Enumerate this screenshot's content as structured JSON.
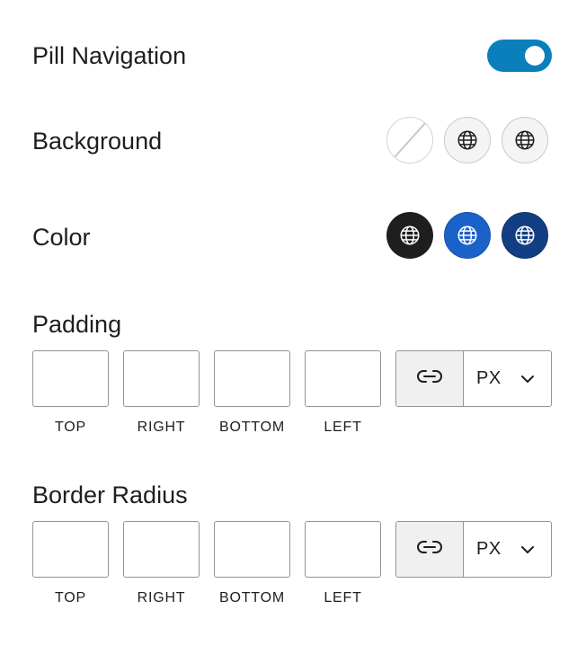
{
  "pill_navigation": {
    "label": "Pill Navigation",
    "enabled": true,
    "toggle_color": "#0a7fbc"
  },
  "background": {
    "label": "Background",
    "swatches": [
      {
        "name": "none",
        "icon": "slash-icon",
        "color": "#ffffff"
      },
      {
        "name": "light-gray",
        "icon": "globe-icon",
        "color": "#f3f4f5"
      },
      {
        "name": "light-gray-alt",
        "icon": "globe-icon",
        "color": "#f3f4f5"
      }
    ]
  },
  "color": {
    "label": "Color",
    "swatches": [
      {
        "name": "black",
        "icon": "globe-icon",
        "color": "#1e1e1e"
      },
      {
        "name": "blue",
        "icon": "globe-icon",
        "color": "#1a62c9"
      },
      {
        "name": "dark-blue",
        "icon": "globe-icon",
        "color": "#123f84"
      }
    ]
  },
  "padding": {
    "label": "Padding",
    "sides": [
      "TOP",
      "RIGHT",
      "BOTTOM",
      "LEFT"
    ],
    "values": [
      "",
      "",
      "",
      ""
    ],
    "unit": "PX",
    "link_icon": "link-icon",
    "dropdown_icon": "chevron-down-icon"
  },
  "border_radius": {
    "label": "Border Radius",
    "sides": [
      "TOP",
      "RIGHT",
      "BOTTOM",
      "LEFT"
    ],
    "values": [
      "",
      "",
      "",
      ""
    ],
    "unit": "PX",
    "link_icon": "link-icon",
    "dropdown_icon": "chevron-down-icon"
  }
}
